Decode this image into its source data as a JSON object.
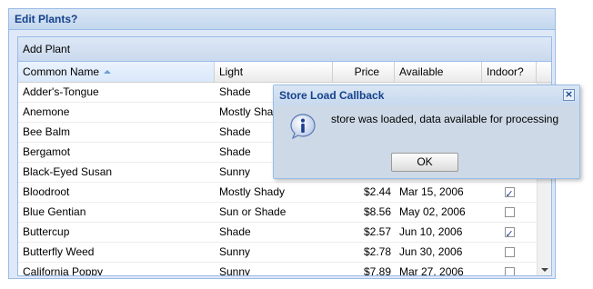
{
  "panel": {
    "title": "Edit Plants?"
  },
  "toolbar": {
    "add_label": "Add Plant"
  },
  "columns": [
    "Common Name",
    "Light",
    "Price",
    "Available",
    "Indoor?"
  ],
  "rows": [
    {
      "name": "Adder's-Tongue",
      "light": "Shade",
      "price": "",
      "available": "",
      "indoor": false
    },
    {
      "name": "Anemone",
      "light": "Mostly Shady",
      "price": "",
      "available": "",
      "indoor": false
    },
    {
      "name": "Bee Balm",
      "light": "Shade",
      "price": "",
      "available": "",
      "indoor": false
    },
    {
      "name": "Bergamot",
      "light": "Shade",
      "price": "",
      "available": "",
      "indoor": false
    },
    {
      "name": "Black-Eyed Susan",
      "light": "Sunny",
      "price": "",
      "available": "",
      "indoor": false
    },
    {
      "name": "Bloodroot",
      "light": "Mostly Shady",
      "price": "$2.44",
      "available": "Mar 15, 2006",
      "indoor": true
    },
    {
      "name": "Blue Gentian",
      "light": "Sun or Shade",
      "price": "$8.56",
      "available": "May 02, 2006",
      "indoor": false
    },
    {
      "name": "Buttercup",
      "light": "Shade",
      "price": "$2.57",
      "available": "Jun 10, 2006",
      "indoor": true
    },
    {
      "name": "Butterfly Weed",
      "light": "Sunny",
      "price": "$2.78",
      "available": "Jun 30, 2006",
      "indoor": false
    },
    {
      "name": "California Poppy",
      "light": "Sunny",
      "price": "$7.89",
      "available": "Mar 27, 2006",
      "indoor": false
    }
  ],
  "dialog": {
    "title": "Store Load Callback",
    "message": "store was loaded, data available for processing",
    "ok_label": "OK",
    "icon": "info-icon"
  },
  "colors": {
    "title_blue": "#15428b",
    "border_blue": "#99bbe8"
  }
}
